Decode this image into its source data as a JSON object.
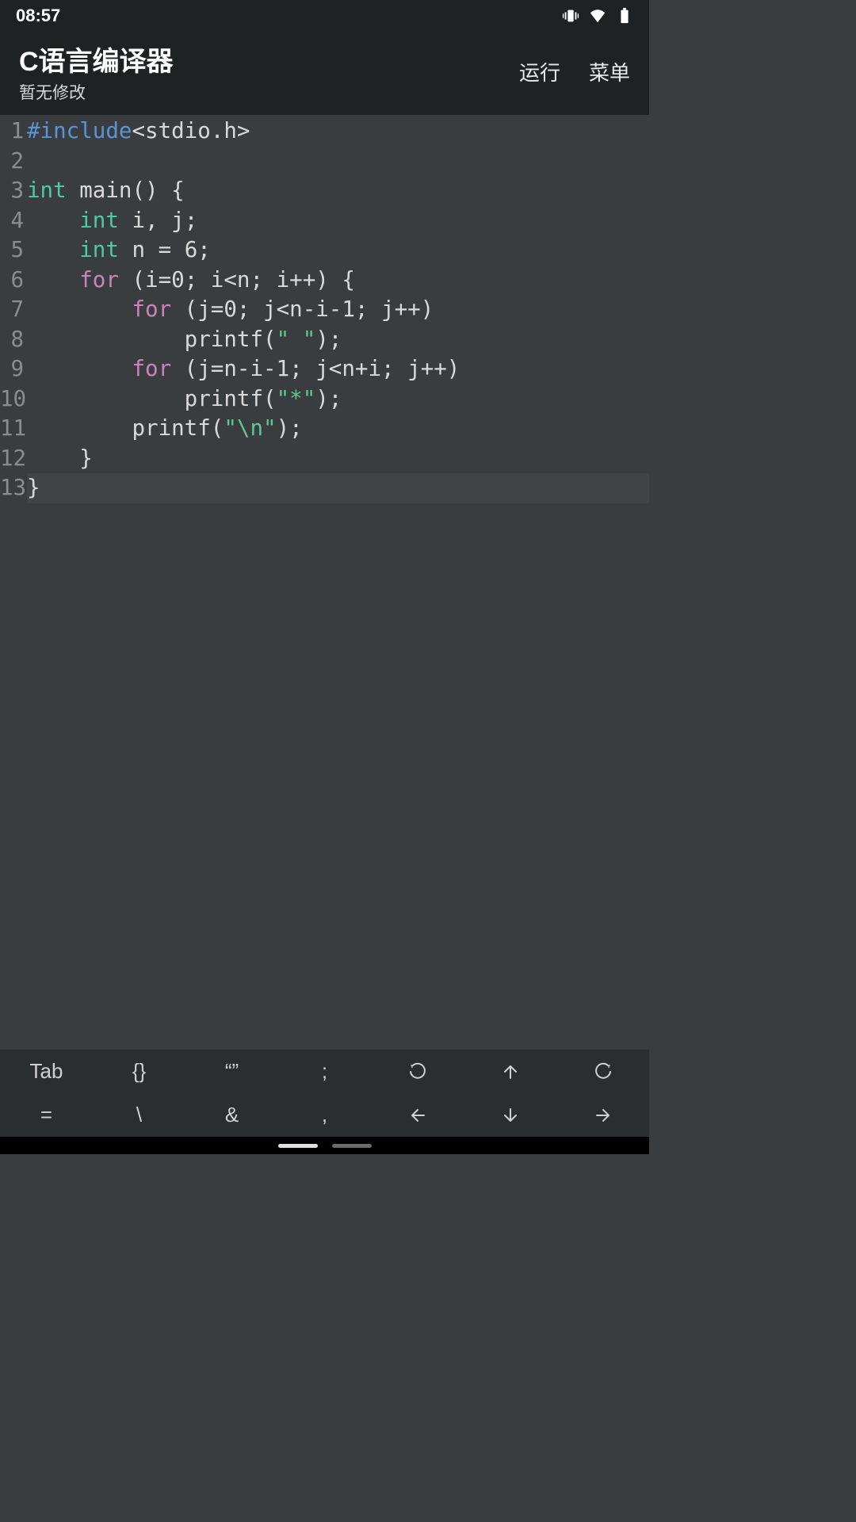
{
  "status": {
    "time": "08:57"
  },
  "header": {
    "title": "C语言编译器",
    "subtitle": "暂无修改",
    "run": "运行",
    "menu": "菜单"
  },
  "code": {
    "lines": [
      {
        "n": "1",
        "tokens": [
          {
            "t": "#include",
            "c": "pre"
          },
          {
            "t": "<stdio.h>",
            "c": ""
          }
        ]
      },
      {
        "n": "2",
        "tokens": []
      },
      {
        "n": "3",
        "tokens": [
          {
            "t": "int",
            "c": "kw-type"
          },
          {
            "t": " main() {",
            "c": ""
          }
        ]
      },
      {
        "n": "4",
        "tokens": [
          {
            "t": "    ",
            "c": ""
          },
          {
            "t": "int",
            "c": "kw-type"
          },
          {
            "t": " i, j;",
            "c": ""
          }
        ]
      },
      {
        "n": "5",
        "tokens": [
          {
            "t": "    ",
            "c": ""
          },
          {
            "t": "int",
            "c": "kw-type"
          },
          {
            "t": " n = 6;",
            "c": ""
          }
        ]
      },
      {
        "n": "6",
        "tokens": [
          {
            "t": "    ",
            "c": ""
          },
          {
            "t": "for",
            "c": "kw-for"
          },
          {
            "t": " (i=0; i<n; i++) {",
            "c": ""
          }
        ]
      },
      {
        "n": "7",
        "tokens": [
          {
            "t": "        ",
            "c": ""
          },
          {
            "t": "for",
            "c": "kw-for"
          },
          {
            "t": " (j=0; j<n-i-1; j++)",
            "c": ""
          }
        ]
      },
      {
        "n": "8",
        "tokens": [
          {
            "t": "            printf(",
            "c": ""
          },
          {
            "t": "\" \"",
            "c": "str"
          },
          {
            "t": ");",
            "c": ""
          }
        ]
      },
      {
        "n": "9",
        "tokens": [
          {
            "t": "        ",
            "c": ""
          },
          {
            "t": "for",
            "c": "kw-for"
          },
          {
            "t": " (j=n-i-1; j<n+i; j++)",
            "c": ""
          }
        ]
      },
      {
        "n": "10",
        "tokens": [
          {
            "t": "            printf(",
            "c": ""
          },
          {
            "t": "\"*\"",
            "c": "str"
          },
          {
            "t": ");",
            "c": ""
          }
        ]
      },
      {
        "n": "11",
        "tokens": [
          {
            "t": "        printf(",
            "c": ""
          },
          {
            "t": "\"\\n\"",
            "c": "str"
          },
          {
            "t": ");",
            "c": ""
          }
        ]
      },
      {
        "n": "12",
        "tokens": [
          {
            "t": "    }",
            "c": ""
          }
        ]
      },
      {
        "n": "13",
        "tokens": [
          {
            "t": "}",
            "c": ""
          }
        ],
        "current": true
      }
    ]
  },
  "toolbar": {
    "row1": [
      "Tab",
      "{}",
      "“”",
      ";",
      "undo-icon",
      "arrow-up-icon",
      "redo-icon"
    ],
    "row2": [
      "=",
      "\\",
      "&",
      ",",
      "arrow-left-icon",
      "arrow-down-icon",
      "arrow-right-icon"
    ]
  }
}
